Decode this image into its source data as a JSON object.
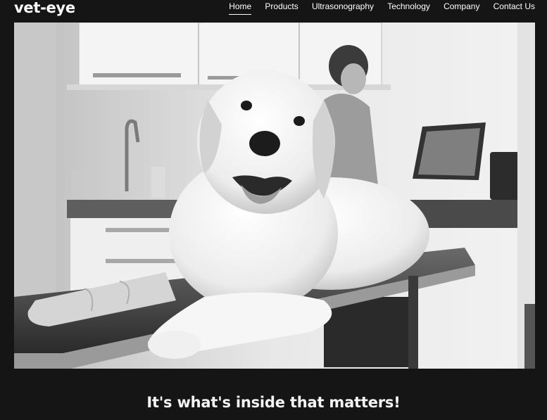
{
  "brand": {
    "logo_text": "vet-eye"
  },
  "nav": {
    "items": [
      {
        "label": "Home",
        "active": true
      },
      {
        "label": "Products",
        "active": false
      },
      {
        "label": "Ultrasonography",
        "active": false
      },
      {
        "label": "Technology",
        "active": false
      },
      {
        "label": "Company",
        "active": false
      },
      {
        "label": "Contact Us",
        "active": false
      }
    ]
  },
  "hero": {
    "image_subject": "dog-on-exam-table-photo"
  },
  "tagline": {
    "text": "It's what's inside that matters!"
  },
  "colors": {
    "background": "#151515",
    "text": "#ffffff"
  }
}
